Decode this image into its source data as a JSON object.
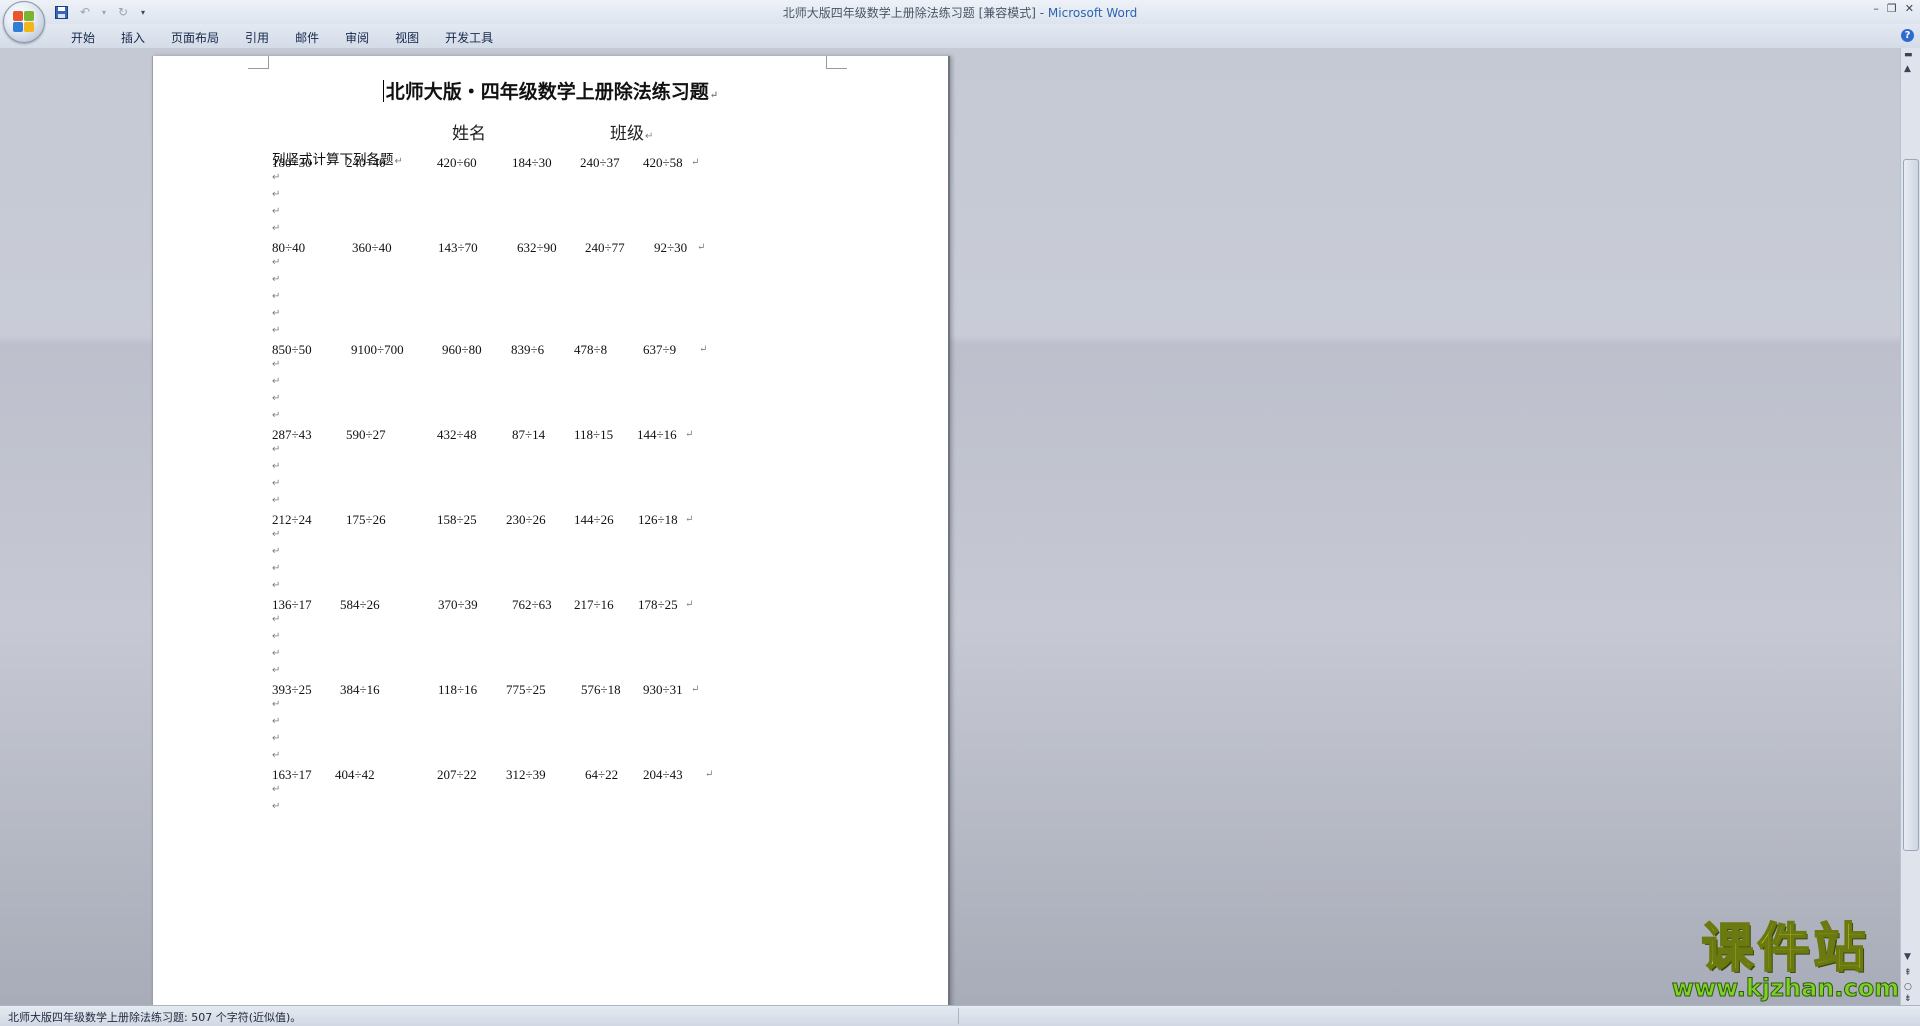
{
  "window": {
    "title_doc": "北师大版四年级数学上册除法练习题 [兼容模式] - ",
    "title_app": "Microsoft Word"
  },
  "ribbon": {
    "tabs": [
      "开始",
      "插入",
      "页面布局",
      "引用",
      "邮件",
      "审阅",
      "视图",
      "开发工具"
    ]
  },
  "document": {
    "title": "北师大版・四年级数学上册除法练习题",
    "name_label": "姓名",
    "class_label": "班级",
    "instruction": "列竖式计算下列各题",
    "rows": [
      [
        "180÷30",
        "240÷40",
        "420÷60",
        "184÷30",
        "240÷37",
        "420÷58"
      ],
      [
        "80÷40",
        "360÷40",
        "143÷70",
        "632÷90",
        "240÷77",
        "92÷30"
      ],
      [
        "850÷50",
        "9100÷700",
        "960÷80",
        "839÷6",
        "478÷8",
        "637÷9"
      ],
      [
        "287÷43",
        "590÷27",
        "432÷48",
        "87÷14",
        "118÷15",
        "144÷16"
      ],
      [
        "212÷24",
        "175÷26",
        "158÷25",
        "230÷26",
        "144÷26",
        "126÷18"
      ],
      [
        "136÷17",
        "584÷26",
        "370÷39",
        "762÷63",
        "217÷16",
        "178÷25"
      ],
      [
        "393÷25",
        "384÷16",
        "118÷16",
        "775÷25",
        "576÷18",
        "930÷31"
      ],
      [
        "163÷17",
        "404÷42",
        "207÷22",
        "312÷39",
        "64÷22",
        "204÷43"
      ]
    ],
    "para_mark": "↵"
  },
  "statusbar": {
    "text": "北师大版四年级数学上册除法练习题: 507 个字符(近似值)。"
  },
  "watermark": {
    "cn": "课件站",
    "url": "www.kjzhan.com"
  },
  "colors": {
    "accent": "#2c63b0",
    "watermark_yellow": "#f5e92a",
    "watermark_green": "#7fd12a"
  }
}
